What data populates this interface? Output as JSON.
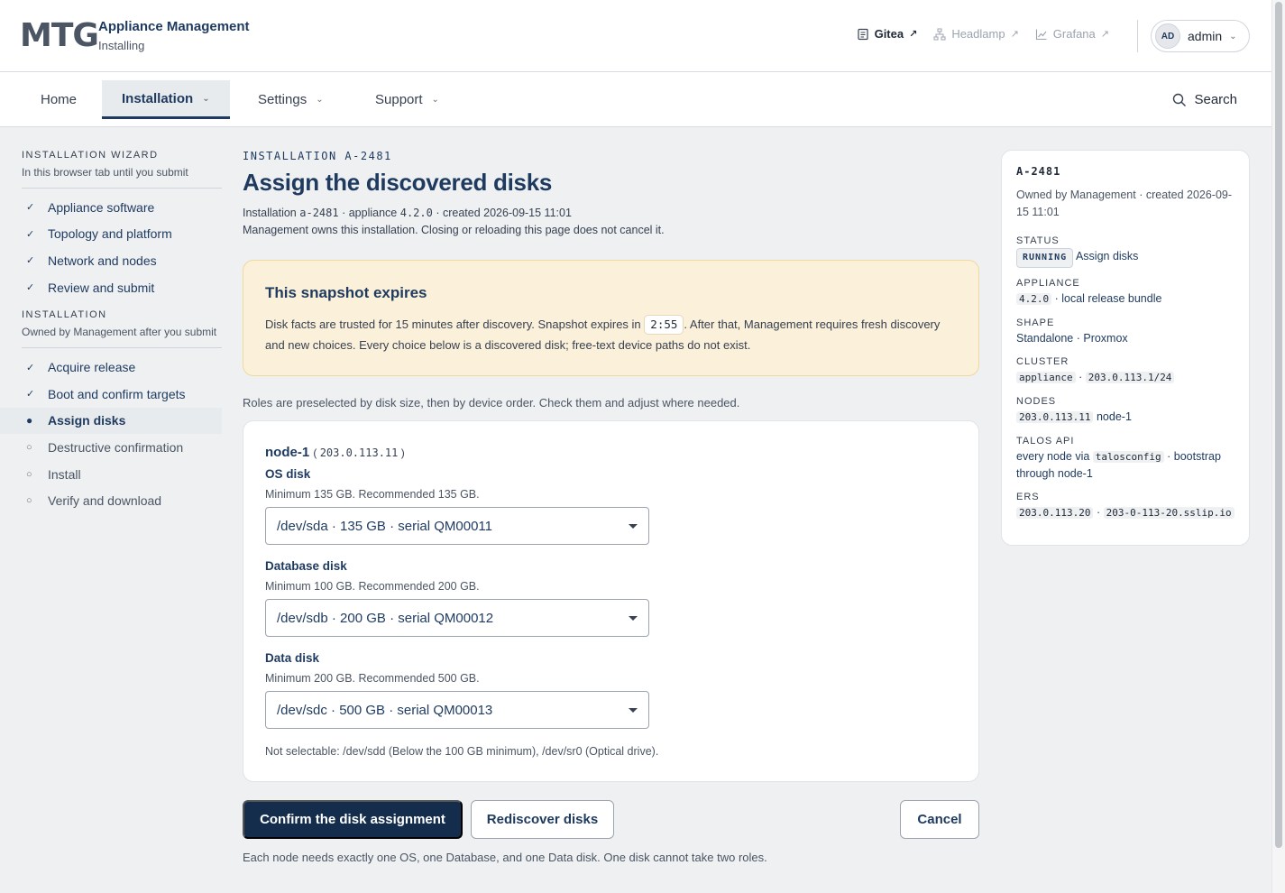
{
  "header": {
    "logo_text": "MTG",
    "app_title": "Appliance Management",
    "app_subtitle": "Installing",
    "ext_links": [
      {
        "label": "Gitea",
        "icon": "document-icon",
        "arrow": "↗"
      },
      {
        "label": "Headlamp",
        "icon": "network-icon",
        "arrow": "↗"
      },
      {
        "label": "Grafana",
        "icon": "chart-icon",
        "arrow": "↗"
      }
    ],
    "user": {
      "initials": "AD",
      "name": "admin",
      "chevron": "⌄"
    }
  },
  "nav": {
    "items": [
      {
        "label": "Home"
      },
      {
        "label": "Installation",
        "chevron": "⌄"
      },
      {
        "label": "Settings",
        "chevron": "⌄"
      },
      {
        "label": "Support",
        "chevron": "⌄"
      }
    ],
    "search_label": "Search"
  },
  "sidebar": {
    "wizard_heading": "INSTALLATION WIZARD",
    "wizard_sub": "In this browser tab until you submit",
    "wizard_steps": [
      {
        "mark": "✓",
        "label": "Appliance software"
      },
      {
        "mark": "✓",
        "label": "Topology and platform"
      },
      {
        "mark": "✓",
        "label": "Network and nodes"
      },
      {
        "mark": "✓",
        "label": "Review and submit"
      }
    ],
    "install_heading": "INSTALLATION",
    "install_sub": "Owned by Management after you submit",
    "install_steps": [
      {
        "mark": "✓",
        "label": "Acquire release"
      },
      {
        "mark": "✓",
        "label": "Boot and confirm targets"
      },
      {
        "mark": "●",
        "label": "Assign disks"
      },
      {
        "mark": "○",
        "label": "Destructive confirmation"
      },
      {
        "mark": "○",
        "label": "Install"
      },
      {
        "mark": "○",
        "label": "Verify and download"
      }
    ]
  },
  "main": {
    "eyebrow": "INSTALLATION A-2481",
    "title": "Assign the discovered disks",
    "meta": {
      "installation_label": "Installation",
      "installation_id": "a-2481",
      "appliance_label": "· appliance",
      "appliance_version": "4.2.0",
      "created": "· created 2026-09-15 11:01",
      "ownership": "Management owns this installation. Closing or reloading this page does not cancel it."
    },
    "warning": {
      "title": "This snapshot expires",
      "body_before": "Disk facts are trusted for 15 minutes after discovery. Snapshot expires in",
      "timer": "2:55",
      "body_after": ". After that, Management requires fresh discovery and new choices. Every choice below is a discovered disk; free-text device paths do not exist."
    },
    "roles_note": "Roles are preselected by disk size, then by device order. Check them and adjust where needed.",
    "node": {
      "name": "node-1",
      "ip": "203.0.113.11",
      "disks": [
        {
          "label": "OS disk",
          "hint": "Minimum 135 GB. Recommended 135 GB.",
          "value": "/dev/sda · 135 GB · serial QM00011"
        },
        {
          "label": "Database disk",
          "hint": "Minimum 100 GB. Recommended 200 GB.",
          "value": "/dev/sdb · 200 GB · serial QM00012"
        },
        {
          "label": "Data disk",
          "hint": "Minimum 200 GB. Recommended 500 GB.",
          "value": "/dev/sdc · 500 GB · serial QM00013"
        }
      ],
      "not_selectable": "Not selectable: /dev/sdd (Below the 100 GB minimum), /dev/sr0 (Optical drive)."
    },
    "buttons": {
      "confirm": "Confirm the disk assignment",
      "rediscover": "Rediscover disks",
      "cancel": "Cancel"
    },
    "footer_note": "Each node needs exactly one OS, one Database, and one Data disk. One disk cannot take two roles."
  },
  "summary": {
    "id": "A-2481",
    "owner": "Owned by Management · created 2026-09-15 11:01",
    "status_label": "STATUS",
    "status_badge": "RUNNING",
    "status_text": "Assign disks",
    "appliance_label": "APPLIANCE",
    "appliance_version": "4.2.0",
    "appliance_text": "· local release bundle",
    "shape_label": "SHAPE",
    "shape_value": "Standalone · Proxmox",
    "cluster_label": "CLUSTER",
    "cluster_name": "appliance",
    "cluster_cidr": "203.0.113.1/24",
    "nodes_label": "NODES",
    "nodes_ip": "203.0.113.11",
    "nodes_name": "node-1",
    "talos_label": "TALOS API",
    "talos_before": "every node via",
    "talos_code": "talosconfig",
    "talos_after": "· bootstrap through node-1",
    "ers_label": "ERS",
    "ers_ip": "203.0.113.20",
    "ers_host": "203-0-113-20.sslip.io"
  },
  "colors": {
    "brand": "#1e3a5f",
    "primary_button": "#142d4c",
    "warning_bg": "#fbf0d9",
    "page_bg": "#eef0f2"
  }
}
